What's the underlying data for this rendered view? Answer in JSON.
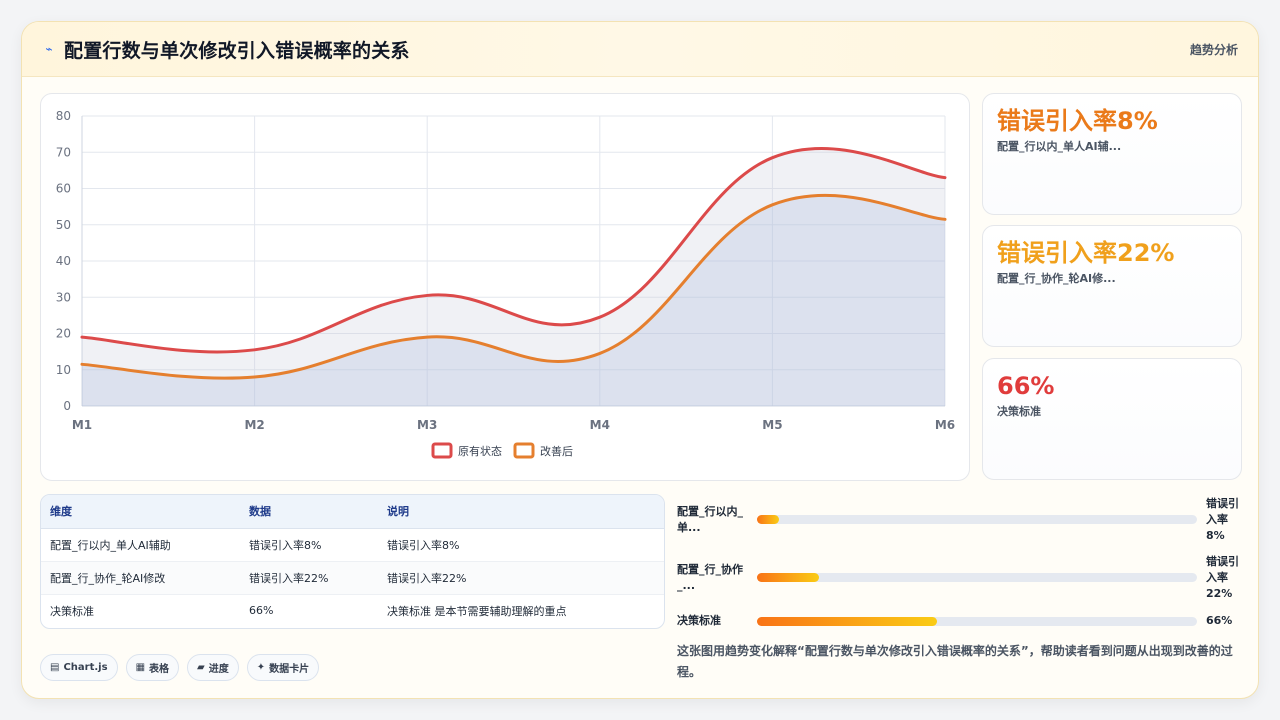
{
  "header": {
    "icon": "zigzag-icon",
    "title": "配置行数与单次修改引入错误概率的关系",
    "tag": "趋势分析"
  },
  "colors": {
    "series1": "#dc4a4a",
    "series2": "#e57f2e",
    "stat1": "#ea7a1a",
    "stat2": "#f0a01c",
    "stat3": "#e03c3c"
  },
  "chart_data": {
    "type": "area",
    "x": [
      "M1",
      "M2",
      "M3",
      "M4",
      "M5",
      "M6"
    ],
    "series": [
      {
        "name": "原有状态",
        "values": [
          19,
          15.5,
          30.5,
          24.5,
          68.5,
          63
        ]
      },
      {
        "name": "改善后",
        "values": [
          11.5,
          8,
          19,
          14.5,
          55.5,
          51.5
        ]
      }
    ],
    "ylim": [
      0,
      80
    ],
    "yticks": [
      0,
      10,
      20,
      30,
      40,
      50,
      60,
      70,
      80
    ],
    "grid": true,
    "legend": "bottom"
  },
  "stats": [
    {
      "value": "错误引入率8%",
      "label": "配置_行以内_单人AI辅..."
    },
    {
      "value": "错误引入率22%",
      "label": "配置_行_协作_轮AI修..."
    },
    {
      "value": "66%",
      "label": "决策标准"
    }
  ],
  "table": {
    "headers": [
      "维度",
      "数据",
      "说明"
    ],
    "rows": [
      [
        "配置_行以内_单人AI辅助",
        "错误引入率8%",
        "错误引入率8%"
      ],
      [
        "配置_行_协作_轮AI修改",
        "错误引入率22%",
        "错误引入率22%"
      ],
      [
        "决策标准",
        "66%",
        "决策标准 是本节需要辅助理解的重点"
      ]
    ]
  },
  "progress": [
    {
      "label": "配置_行以内_单...",
      "value_text": "错误引入率8%",
      "fraction": 0.05
    },
    {
      "label": "配置_行_协作_...",
      "value_text": "错误引入率22%",
      "fraction": 0.14
    },
    {
      "label": "决策标准",
      "value_text": "66%",
      "fraction": 0.41
    }
  ],
  "chips": [
    {
      "icon": "chart-icon",
      "label": "Chart.js"
    },
    {
      "icon": "table-icon",
      "label": "表格"
    },
    {
      "icon": "progress-icon",
      "label": "进度"
    },
    {
      "icon": "sparkle-icon",
      "label": "数据卡片"
    }
  ],
  "note": "这张图用趋势变化解释“配置行数与单次修改引入错误概率的关系”，帮助读者看到问题从出现到改善的过程。"
}
